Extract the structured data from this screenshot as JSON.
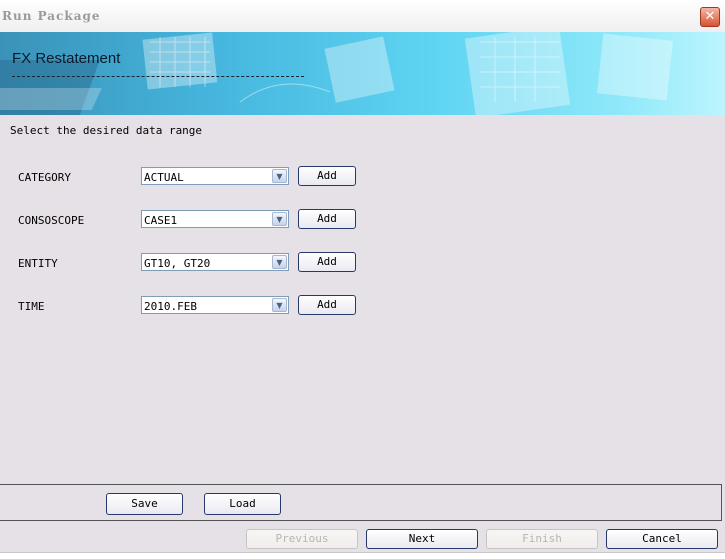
{
  "window": {
    "title": "Run Package",
    "close_label": "✕"
  },
  "banner": {
    "title": "FX Restatement"
  },
  "instruction": "Select the desired data range",
  "dimensions": [
    {
      "label": "CATEGORY",
      "value": "ACTUAL",
      "add_label": "Add"
    },
    {
      "label": "CONSOSCOPE",
      "value": "CASE1",
      "add_label": "Add"
    },
    {
      "label": "ENTITY",
      "value": "GT10, GT20",
      "add_label": "Add"
    },
    {
      "label": "TIME",
      "value": "2010.FEB",
      "add_label": "Add"
    }
  ],
  "actions": {
    "save": "Save",
    "load": "Load"
  },
  "navigation": {
    "previous": "Previous",
    "next": "Next",
    "finish": "Finish",
    "cancel": "Cancel",
    "previous_enabled": false,
    "finish_enabled": false
  },
  "icons": {
    "dropdown": "chevron-down-icon",
    "close": "close-icon"
  },
  "colors": {
    "banner_start": "#3a92b8",
    "banner_end": "#bdf5fd",
    "button_border": "#27386b",
    "background": "#e6e1e6"
  }
}
